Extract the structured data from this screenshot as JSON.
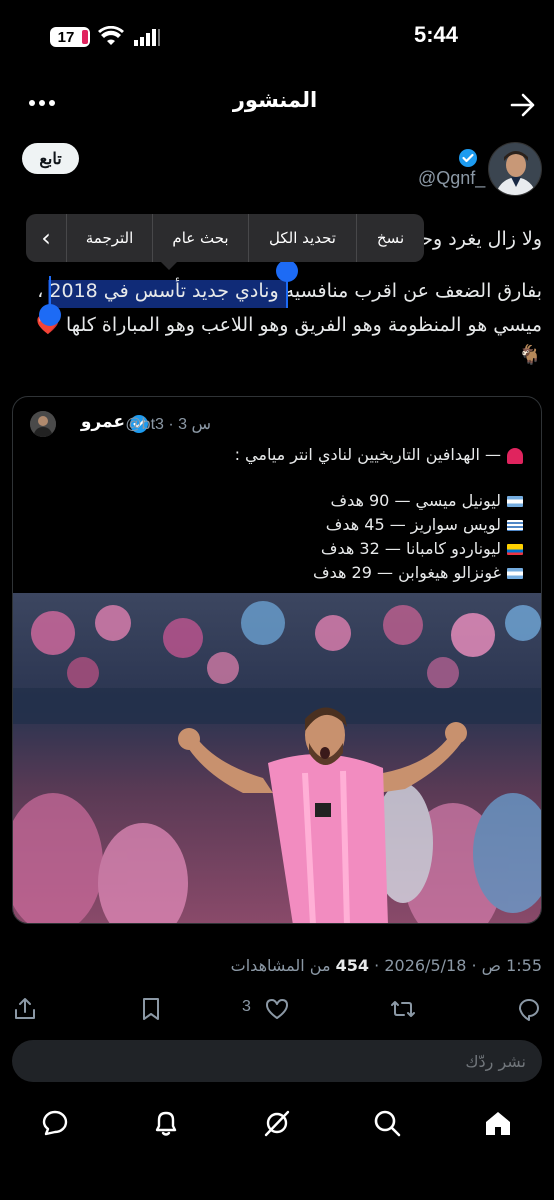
{
  "status_bar": {
    "time": "5:44",
    "battery": "17"
  },
  "header": {
    "title": "المنشور"
  },
  "author": {
    "handle": "@Qgnf_",
    "follow_label": "تابع"
  },
  "post": {
    "line1": "ولا زال يغرد وحـ",
    "line2": "بفارق الضعف عن اقرب منافسيه ونادي جديد تأسس في 2018 ،",
    "line3": "ميسي هو المنظومة وهو الفريق وهو اللاعب وهو المباراة كلها",
    "line4": "🐐",
    "heart": "❤️"
  },
  "context_menu": {
    "copy": "نسخ",
    "select_all": "تحديد الكل",
    "search": "بحث عام",
    "translate": "الترجمة",
    "next": "›"
  },
  "quote": {
    "name": "عمرو",
    "meta": "@bt3 · 3 س",
    "line1": "— الهدافين التاريخيين لنادي انتر ميامي :",
    "scorers": [
      "ليونيل ميسي — 90 هدف",
      "لويس سواريز — 45 هدف",
      "ليوناردو كامبانا — 32 هدف",
      "غونزالو هيغوابن — 29 هدف"
    ]
  },
  "post_meta": {
    "time": "1:55 ص · 2026/5/18 ·",
    "views_count": "454",
    "views_label": "من المشاهدات"
  },
  "actions": {
    "like_count": "3"
  },
  "reply": {
    "placeholder": "نشر ردّك"
  },
  "colors": {
    "accent": "#1d9bf0",
    "selection": "#1d6bf5",
    "background": "#000000"
  }
}
